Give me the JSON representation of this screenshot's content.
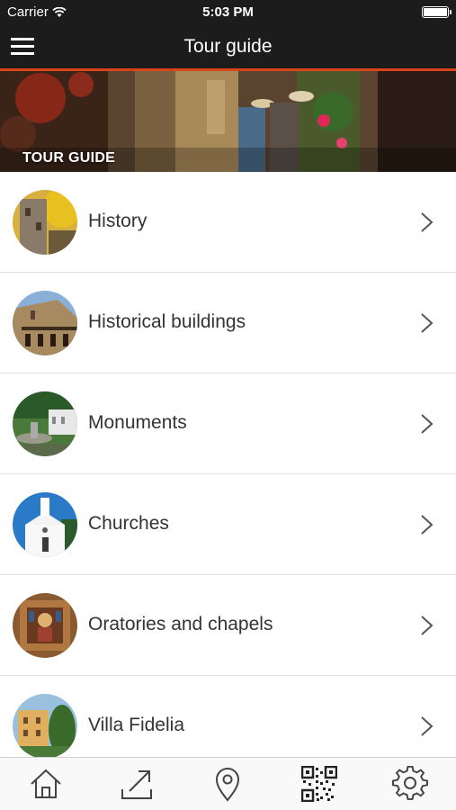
{
  "status_bar": {
    "carrier": "Carrier",
    "time": "5:03 PM"
  },
  "nav": {
    "title": "Tour guide",
    "menu_icon": "hamburger-menu-icon"
  },
  "hero": {
    "label": "TOUR GUIDE"
  },
  "list": {
    "items": [
      {
        "label": "History"
      },
      {
        "label": "Historical buildings"
      },
      {
        "label": "Monuments"
      },
      {
        "label": "Churches"
      },
      {
        "label": "Oratories and chapels"
      },
      {
        "label": "Villa Fidelia"
      }
    ]
  },
  "tab_bar": {
    "tabs": [
      {
        "icon": "home-icon"
      },
      {
        "icon": "share-icon"
      },
      {
        "icon": "location-pin-icon"
      },
      {
        "icon": "qr-code-icon"
      },
      {
        "icon": "settings-gear-icon"
      }
    ]
  },
  "colors": {
    "accent": "#d8431a",
    "bar": "#1c1c1c",
    "text": "#333333"
  }
}
